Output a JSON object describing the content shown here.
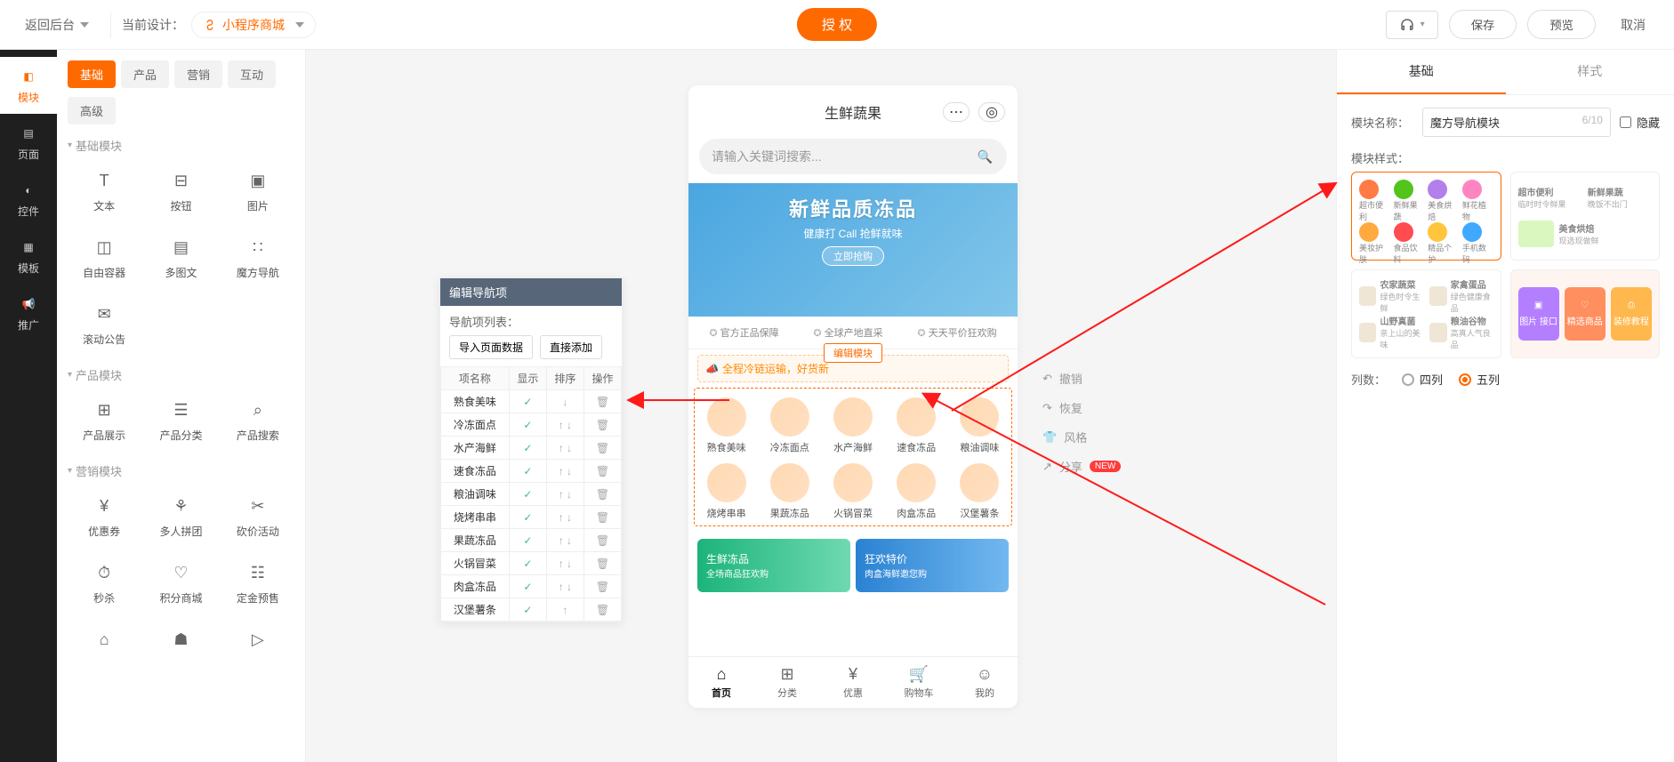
{
  "header": {
    "back": "返回后台",
    "currentDesignLabel": "当前设计：",
    "currentDesign": "小程序商城",
    "authorize": "授 权",
    "save": "保存",
    "preview": "预览",
    "cancel": "取消"
  },
  "leftNav": {
    "items": [
      {
        "label": "模块",
        "icon": "◧"
      },
      {
        "label": "页面",
        "icon": "▤"
      },
      {
        "label": "控件",
        "icon": "◐"
      },
      {
        "label": "模板",
        "icon": "▦"
      },
      {
        "label": "推广",
        "icon": "📢"
      }
    ]
  },
  "compPanel": {
    "tabs": [
      "基础",
      "产品",
      "营销",
      "互动"
    ],
    "tabs2": [
      "高级"
    ],
    "sections": [
      {
        "title": "基础模块",
        "items": [
          {
            "label": "文本",
            "icon": "T"
          },
          {
            "label": "按钮",
            "icon": "⊟"
          },
          {
            "label": "图片",
            "icon": "▣"
          },
          {
            "label": "自由容器",
            "icon": "◫"
          },
          {
            "label": "多图文",
            "icon": "▤"
          },
          {
            "label": "魔方导航",
            "icon": "∷"
          },
          {
            "label": "滚动公告",
            "icon": "✉"
          }
        ]
      },
      {
        "title": "产品模块",
        "items": [
          {
            "label": "产品展示",
            "icon": "⊞"
          },
          {
            "label": "产品分类",
            "icon": "☰"
          },
          {
            "label": "产品搜索",
            "icon": "⌕"
          }
        ]
      },
      {
        "title": "营销模块",
        "items": [
          {
            "label": "优惠券",
            "icon": "¥"
          },
          {
            "label": "多人拼团",
            "icon": "⚘"
          },
          {
            "label": "砍价活动",
            "icon": "✂"
          },
          {
            "label": "秒杀",
            "icon": "⏱"
          },
          {
            "label": "积分商城",
            "icon": "♡"
          },
          {
            "label": "定金预售",
            "icon": "☷"
          },
          {
            "label": "",
            "icon": "⌂"
          },
          {
            "label": "",
            "icon": "☗"
          },
          {
            "label": "",
            "icon": "▷"
          }
        ]
      }
    ]
  },
  "phone": {
    "title": "生鲜蔬果",
    "searchPlaceholder": "请输入关键词搜索...",
    "banner": {
      "title": "新鲜品质冻品",
      "sub": "健康打 Call 抢鲜就味",
      "cta": "立即抢购"
    },
    "tags": [
      "官方正品保障",
      "全球产地直采",
      "天天平价狂欢购"
    ],
    "notice": "全程冷链运输，好货新",
    "editModule": "编辑模块",
    "navItems": [
      "熟食美味",
      "冷冻面点",
      "水产海鲜",
      "速食冻品",
      "粮油调味",
      "烧烤串串",
      "果蔬冻品",
      "火锅冒菜",
      "肉盒冻品",
      "汉堡薯条"
    ],
    "promos": [
      {
        "t1": "生鲜冻品",
        "t2": "全场商品狂欢购"
      },
      {
        "t1": "狂欢特价",
        "t2": "肉盒海鲜邀您购"
      }
    ],
    "tabbar": [
      {
        "label": "首页",
        "icon": "⌂"
      },
      {
        "label": "分类",
        "icon": "⊞"
      },
      {
        "label": "优惠",
        "icon": "¥"
      },
      {
        "label": "购物车",
        "icon": "🛒"
      },
      {
        "label": "我的",
        "icon": "☺"
      }
    ]
  },
  "popover": {
    "title": "编辑导航项",
    "subtitle": "导航项列表：",
    "btnImport": "导入页面数据",
    "btnAdd": "直接添加",
    "headers": [
      "项名称",
      "显示",
      "排序",
      "操作"
    ],
    "rows": [
      "熟食美味",
      "冷冻面点",
      "水产海鲜",
      "速食冻品",
      "粮油调味",
      "烧烤串串",
      "果蔬冻品",
      "火锅冒菜",
      "肉盒冻品",
      "汉堡薯条"
    ]
  },
  "canvasActions": {
    "undo": "撤销",
    "redo": "恢复",
    "theme": "风格",
    "share": "分享",
    "new": "NEW"
  },
  "rightPanel": {
    "tabBasic": "基础",
    "tabStyle": "样式",
    "nameLabel": "模块名称：",
    "nameValue": "魔方导航模块",
    "nameCount": "6/10",
    "hide": "隐藏",
    "styleLabel": "模块样式：",
    "tpl1": {
      "r1": [
        "超市便利",
        "新鲜果蔬",
        "美食烘焙",
        "鲜花植物"
      ],
      "r2": [
        "美妆护肤",
        "食品饮料",
        "精品个护",
        "手机数码"
      ]
    },
    "tpl2": {
      "t1a": "超市便利",
      "t1b": "临时时令鲜果",
      "t2a": "新鲜果蔬",
      "t2b": "晚饭不出门",
      "t3a": "美食烘焙",
      "t3b": "现选现做鲜"
    },
    "tpl3": {
      "items": [
        {
          "a": "农家蔬菜",
          "b": "绿色时令生鲜"
        },
        {
          "a": "家禽蛋品",
          "b": "绿色健康食品"
        },
        {
          "a": "山野真菌",
          "b": "亲上山的美味"
        },
        {
          "a": "粮油谷物",
          "b": "高真人气良品"
        }
      ]
    },
    "tpl4": {
      "chips": [
        "图片 接口",
        "精选商品",
        "装修教程"
      ]
    },
    "colsLabel": "列数：",
    "col4": "四列",
    "col5": "五列"
  }
}
